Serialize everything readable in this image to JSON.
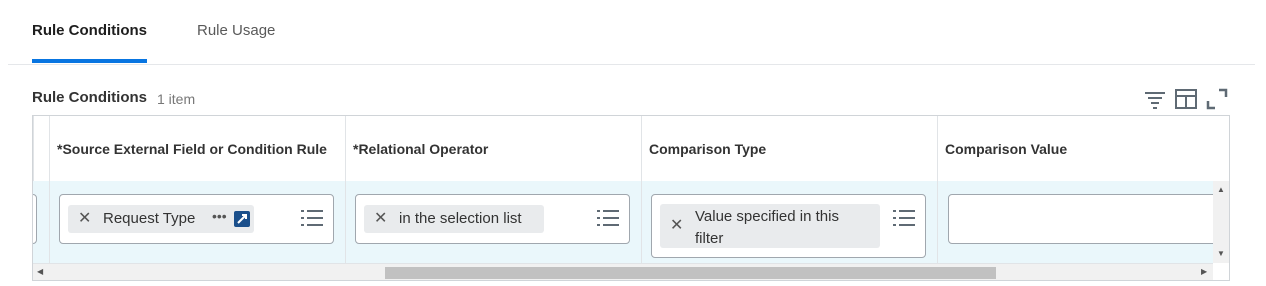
{
  "tabs": {
    "conditions_label": "Rule Conditions",
    "usage_label": "Rule Usage"
  },
  "grid": {
    "title": "Rule Conditions",
    "count": "1 item",
    "toolbar_icons": [
      "filter-icon",
      "columns-icon",
      "expand-icon"
    ]
  },
  "columns": [
    "*Source External Field or Condition Rule",
    "*Relational Operator",
    "Comparison Type",
    "Comparison Value"
  ],
  "row": {
    "source_value": "Request Type",
    "operator_value": "in the selection list",
    "comparison_type_value": "Value specified in this filter",
    "comparison_value": ""
  },
  "colors": {
    "accent": "#0875e1",
    "row_highlight": "#eaf7fb",
    "pill": "#e9ebed"
  }
}
